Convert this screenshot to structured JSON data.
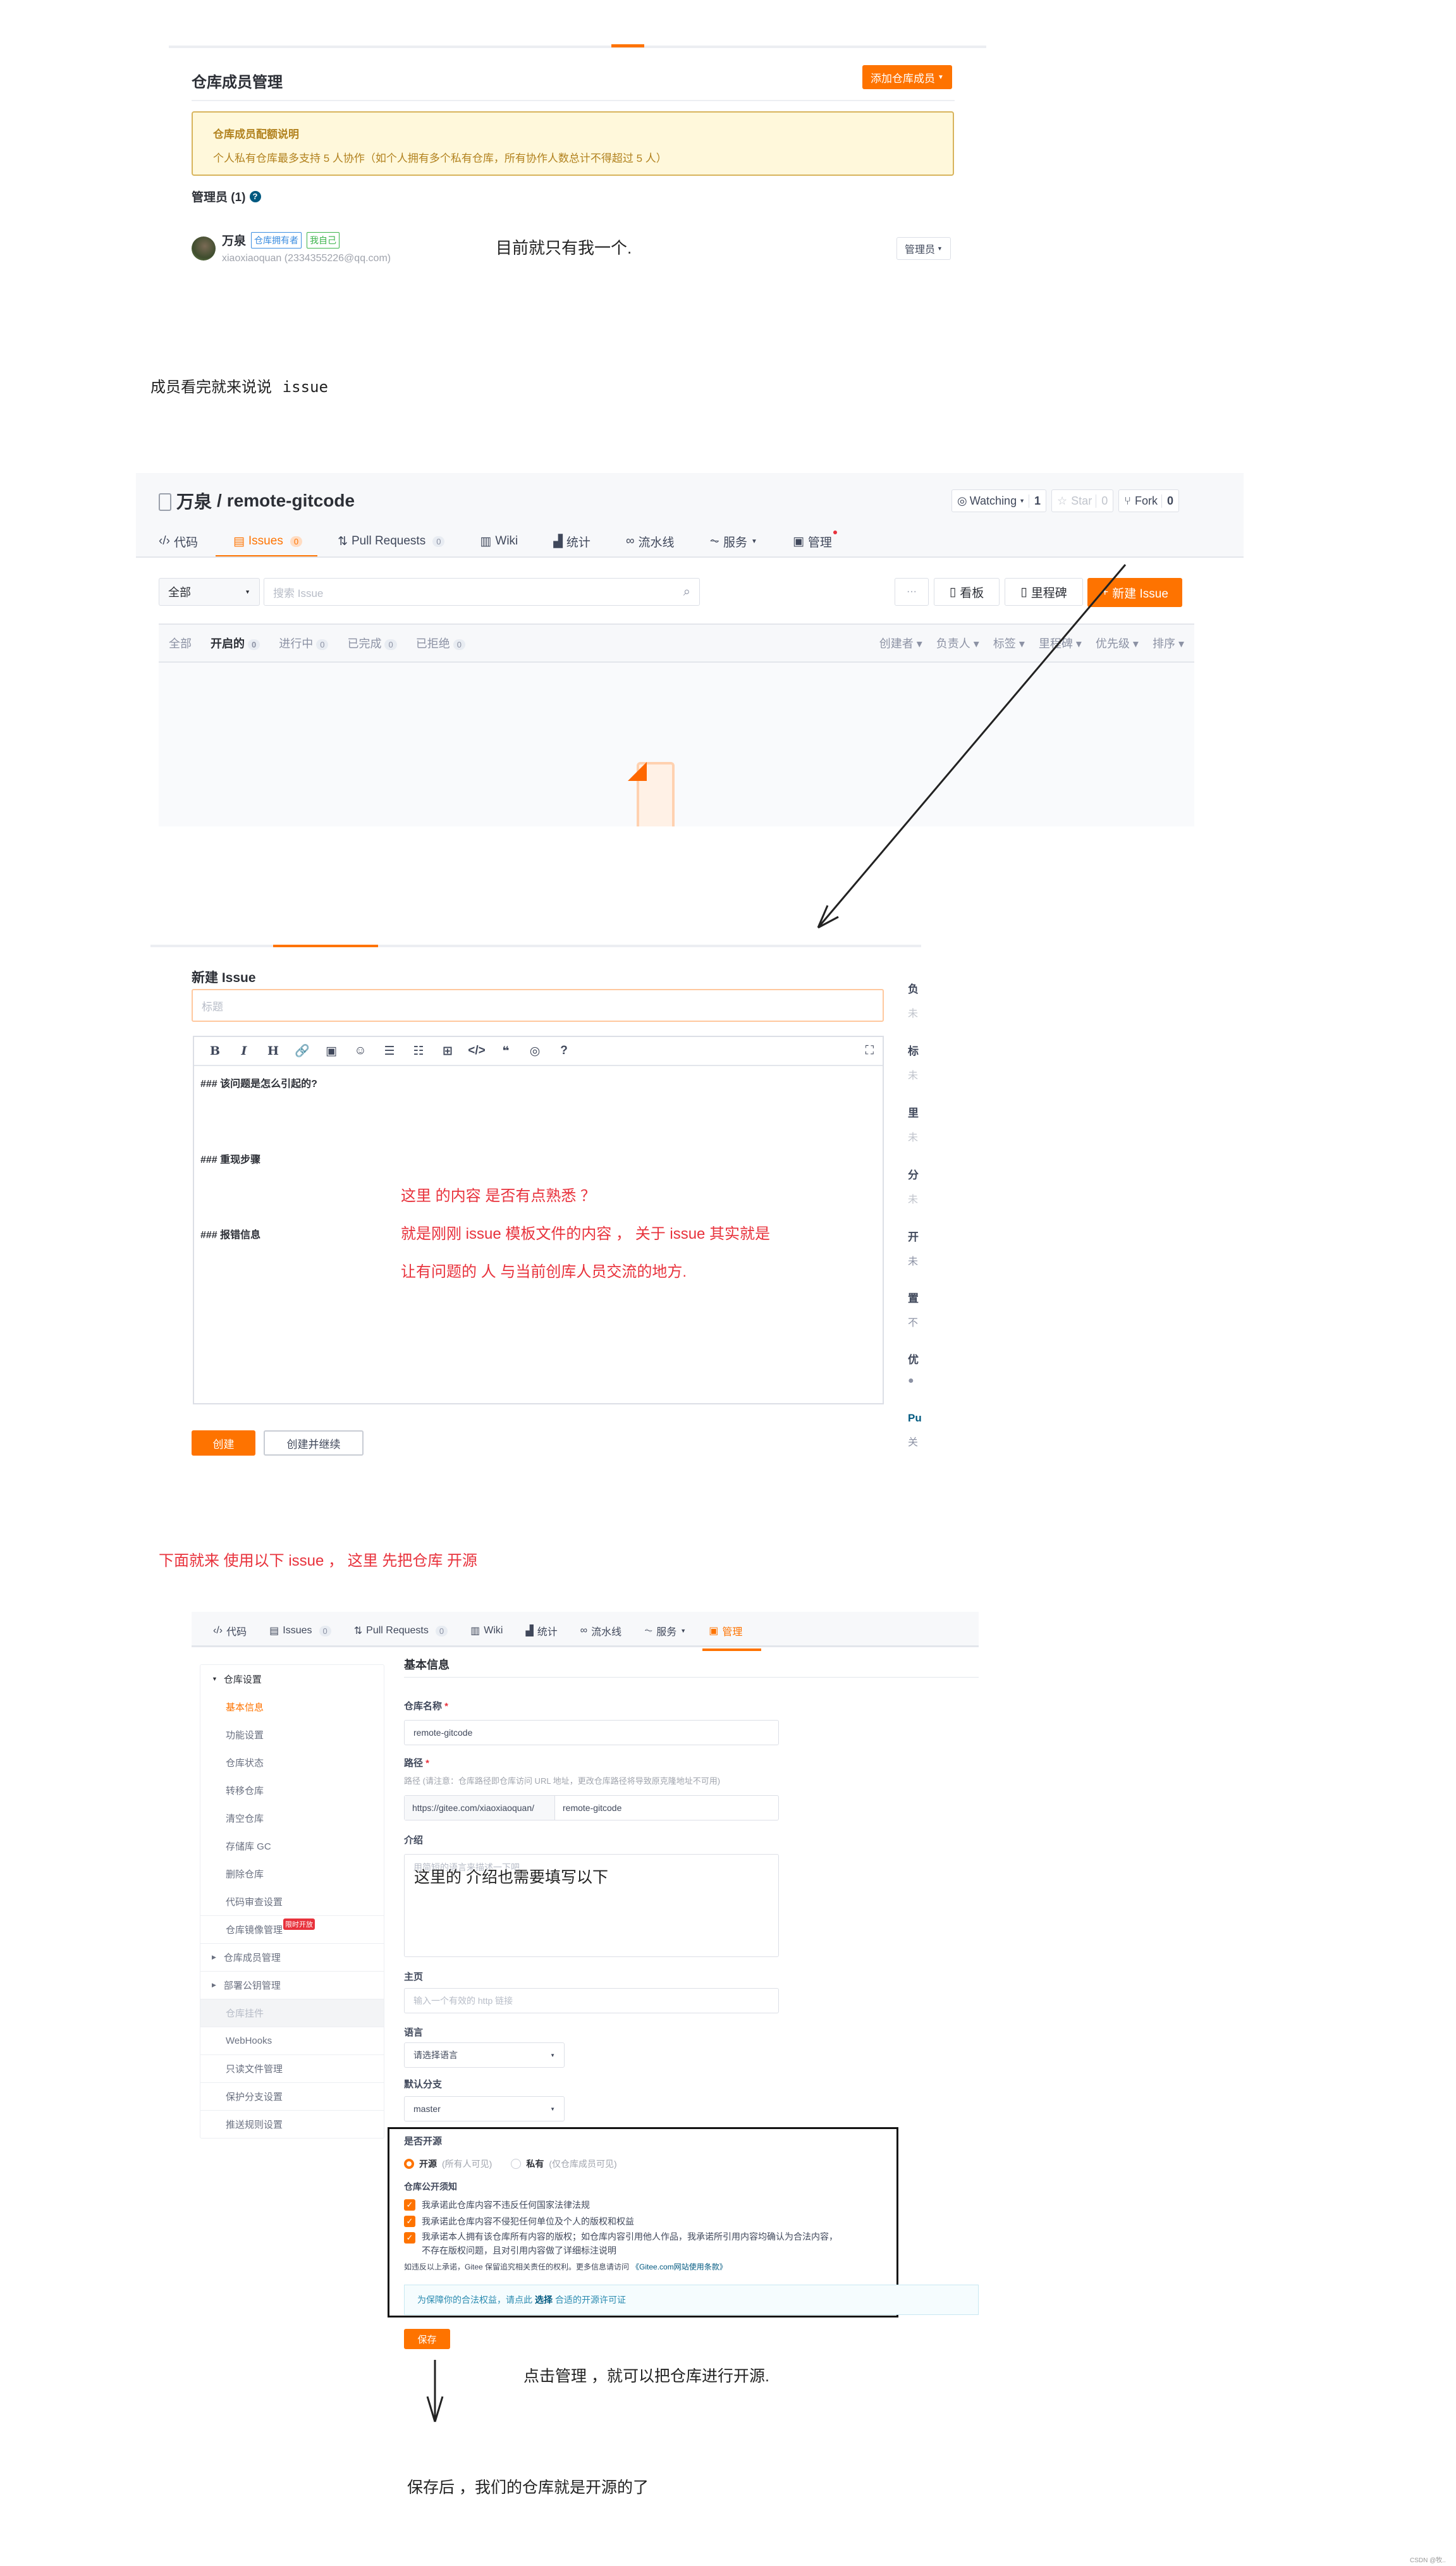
{
  "members": {
    "title": "仓库成员管理",
    "add_button": "添加仓库成员",
    "quota": {
      "title": "仓库成员配额说明",
      "text": "个人私有仓库最多支持 5 人协作（如个人拥有多个私有仓库，所有协作人数总计不得超过 5 人）"
    },
    "admins_label": "管理员 (1)",
    "member": {
      "name": "万泉",
      "badge_owner": "仓库拥有者",
      "badge_self": "我自己",
      "account": "xiaoxiaoquan (2334355226@qq.com)",
      "role": "管理员"
    },
    "annotation": "目前就只有我一个."
  },
  "note_issue": {
    "prefix": "成员看完就来说说",
    "code": "issue"
  },
  "repo": {
    "owner": "万泉",
    "name": "remote-gitcode",
    "watching": "Watching",
    "watching_count": "1",
    "star": "Star",
    "star_count": "0",
    "fork": "Fork",
    "fork_count": "0",
    "tabs": [
      {
        "label": "代码",
        "icon": "code-icon"
      },
      {
        "label": "Issues",
        "count": "0",
        "icon": "issues-icon"
      },
      {
        "label": "Pull Requests",
        "count": "0",
        "icon": "pull-request-icon"
      },
      {
        "label": "Wiki",
        "icon": "wiki-icon"
      },
      {
        "label": "统计",
        "icon": "chart-icon"
      },
      {
        "label": "流水线",
        "icon": "pipeline-icon"
      },
      {
        "label": "服务",
        "icon": "service-icon"
      },
      {
        "label": "管理",
        "icon": "settings-icon"
      }
    ],
    "filter_select": "全部",
    "search_placeholder": "搜索 Issue",
    "more": "···",
    "kanban": "看板",
    "milestone": "里程碑",
    "new_issue": "新建 Issue",
    "states": [
      {
        "label": "全部"
      },
      {
        "label": "开启的",
        "count": "0"
      },
      {
        "label": "进行中",
        "count": "0"
      },
      {
        "label": "已完成",
        "count": "0"
      },
      {
        "label": "已拒绝",
        "count": "0"
      }
    ],
    "sorts": [
      "创建者",
      "负责人",
      "标签",
      "里程碑",
      "优先级",
      "排序"
    ]
  },
  "new_issue": {
    "title": "新建 Issue",
    "title_placeholder": "标题",
    "toolbar": [
      "bold-icon",
      "italic-icon",
      "heading-icon",
      "link-icon",
      "image-icon",
      "emoji-icon",
      "bullet-list-icon",
      "ordered-list-icon",
      "table-icon",
      "code-icon",
      "quote-icon",
      "preview-icon",
      "help-icon"
    ],
    "toolbar_glyphs": [
      "B",
      "I",
      "H",
      "🔗",
      "▣",
      "☺",
      "☰",
      "☷",
      "⊞",
      "</>",
      "❝",
      "◎",
      "?"
    ],
    "fullscreen": "⛶",
    "body_lines": [
      "### 该问题是怎么引起的?",
      "### 重现步骤",
      "### 报错信息"
    ],
    "annotation": [
      "这里 的内容 是否有点熟悉 ？",
      "就是刚刚 issue 模板文件的内容 ， 关于 issue 其实就是",
      "让有问题的 人 与当前创库人员交流的地方."
    ],
    "create": "创建",
    "create_continue": "创建并继续",
    "sidebar": [
      {
        "label": "负",
        "value": "未"
      },
      {
        "label": "标",
        "value": "未"
      },
      {
        "label": "里",
        "value": "未"
      },
      {
        "label": "分",
        "value": "未"
      },
      {
        "label": "开",
        "value": "未"
      },
      {
        "label": "置",
        "value": "不"
      },
      {
        "label": "优",
        "value": "●"
      },
      {
        "label": "Pu",
        "value": "关"
      }
    ]
  },
  "note_open": "下面就来 使用以下 issue ， 这里 先把仓库 开源",
  "settings": {
    "sidebar": {
      "group": "仓库设置",
      "items": [
        "基本信息",
        "功能设置",
        "仓库状态",
        "转移仓库",
        "清空仓库",
        "存储库 GC",
        "删除仓库",
        "代码审查设置"
      ],
      "mirror": "仓库镜像管理",
      "mirror_badge": "限时开放",
      "members": "仓库成员管理",
      "deploy_keys": "部署公钥管理",
      "widget": "仓库挂件",
      "rest": [
        "WebHooks",
        "只读文件管理",
        "保护分支设置",
        "推送规则设置"
      ]
    },
    "heading": "基本信息",
    "name_label": "仓库名称",
    "name_value": "remote-gitcode",
    "path_label": "路径",
    "path_hint": "路径 (请注意：仓库路径即仓库访问 URL 地址，更改仓库路径将导致原克隆地址不可用)",
    "path_prefix": "https://gitee.com/xiaoxiaoquan/",
    "path_value": "remote-gitcode",
    "intro_label": "介绍",
    "intro_placeholder": "用简短的语言来描述一下吧",
    "intro_annotation": "这里的 介绍也需要填写以下",
    "homepage_label": "主页",
    "homepage_placeholder": "输入一个有效的 http 链接",
    "language_label": "语言",
    "language_value": "请选择语言",
    "branch_label": "默认分支",
    "branch_value": "master",
    "open_label": "是否开源",
    "open_option": "开源",
    "open_desc": "(所有人可见)",
    "private_option": "私有",
    "private_desc": "(仅仓库成员可见)",
    "open_selected": "开源",
    "notice_label": "仓库公开须知",
    "checks": [
      "我承诺此仓库内容不违反任何国家法律法规",
      "我承诺此仓库内容不侵犯任何单位及个人的版权和权益",
      "我承诺本人拥有该仓库所有内容的版权；如仓库内容引用他人作品，我承诺所引用内容均确认为合法内容，",
      "不存在版权问题，且对引用内容做了详细标注说明"
    ],
    "terms_prefix": "如违反以上承诺，Gitee 保留追究相关责任的权利。更多信息请访问",
    "terms_link": "《Gitee.com网站使用条款》",
    "license_prefix": "为保障你的合法权益，请点此",
    "license_link": "选择",
    "license_suffix": "合适的开源许可证",
    "save": "保存"
  },
  "note_click": "点击管理 ，就可以把仓库进行开源.",
  "note_saved": "保存后 ，我们的仓库就是开源的了",
  "watermark": "CSDN @牧..",
  "colors": {
    "accent": "#fe7300",
    "annotation_red": "#e8323c",
    "link_blue": "#005980"
  }
}
